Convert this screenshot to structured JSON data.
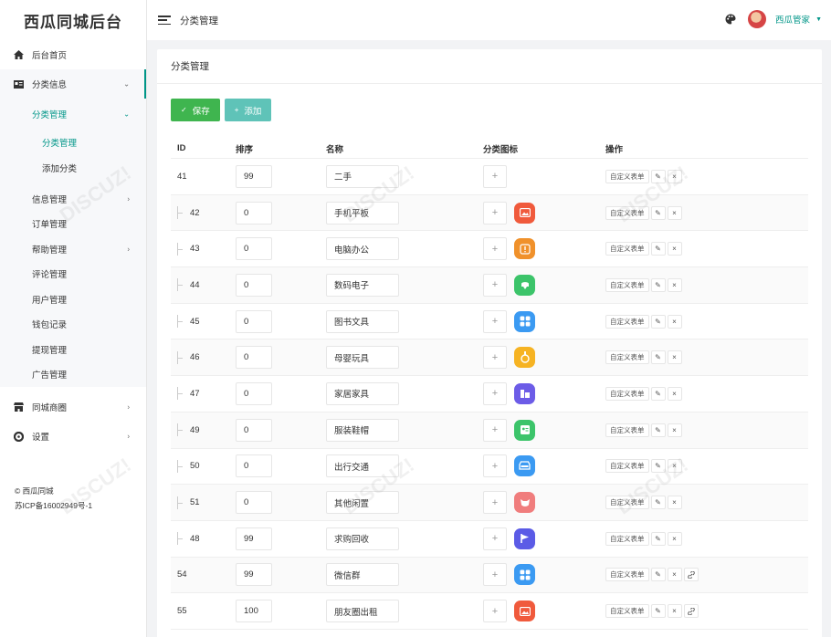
{
  "app": {
    "title": "西瓜同城后台"
  },
  "sidebar": {
    "items": [
      {
        "label": "后台首页",
        "icon": "home-icon"
      },
      {
        "label": "分类信息",
        "icon": "card-icon"
      }
    ],
    "category_sub": {
      "label": "分类管理",
      "children": [
        {
          "label": "分类管理"
        },
        {
          "label": "添加分类"
        }
      ]
    },
    "info_items": [
      {
        "label": "信息管理",
        "has_arrow": true
      },
      {
        "label": "订单管理",
        "has_arrow": false
      },
      {
        "label": "帮助管理",
        "has_arrow": true
      },
      {
        "label": "评论管理",
        "has_arrow": false
      },
      {
        "label": "用户管理",
        "has_arrow": false
      },
      {
        "label": "钱包记录",
        "has_arrow": false
      },
      {
        "label": "提现管理",
        "has_arrow": false
      },
      {
        "label": "广告管理",
        "has_arrow": false
      }
    ],
    "bottom_items": [
      {
        "label": "同城商圈",
        "icon": "shop-icon"
      },
      {
        "label": "设置",
        "icon": "gear-icon"
      }
    ],
    "footer": {
      "copyright": "© 西瓜同城",
      "icp": "苏ICP备16002949号-1"
    }
  },
  "header": {
    "title": "分类管理",
    "username": "西瓜管家"
  },
  "card": {
    "title": "分类管理"
  },
  "toolbar": {
    "save_label": "保存",
    "add_label": "添加"
  },
  "table": {
    "columns": [
      "ID",
      "排序",
      "名称",
      "分类图标",
      "操作"
    ],
    "op_label": "自定义表单",
    "rows": [
      {
        "id": "41",
        "sort": "99",
        "name": "二手",
        "child": false,
        "icon": null,
        "link": false
      },
      {
        "id": "42",
        "sort": "0",
        "name": "手机平板",
        "child": true,
        "icon": {
          "name": "image-icon",
          "color": "#f05a3c"
        },
        "link": false
      },
      {
        "id": "43",
        "sort": "0",
        "name": "电脑办公",
        "child": true,
        "icon": {
          "name": "info-icon",
          "color": "#f0912b"
        },
        "link": false
      },
      {
        "id": "44",
        "sort": "0",
        "name": "数码电子",
        "child": true,
        "icon": {
          "name": "robot-icon",
          "color": "#3cc46a"
        },
        "link": false
      },
      {
        "id": "45",
        "sort": "0",
        "name": "图书文具",
        "child": true,
        "icon": {
          "name": "grid-icon",
          "color": "#3b9af2"
        },
        "link": false
      },
      {
        "id": "46",
        "sort": "0",
        "name": "母婴玩具",
        "child": true,
        "icon": {
          "name": "medal-icon",
          "color": "#f6b323"
        },
        "link": false
      },
      {
        "id": "47",
        "sort": "0",
        "name": "家居家具",
        "child": true,
        "icon": {
          "name": "building-icon",
          "color": "#6c5ce7"
        },
        "link": false
      },
      {
        "id": "49",
        "sort": "0",
        "name": "服装鞋帽",
        "child": true,
        "icon": {
          "name": "id-card-icon",
          "color": "#3cc46a"
        },
        "link": false
      },
      {
        "id": "50",
        "sort": "0",
        "name": "出行交通",
        "child": true,
        "icon": {
          "name": "car-icon",
          "color": "#3b9af2"
        },
        "link": false
      },
      {
        "id": "51",
        "sort": "0",
        "name": "其他闲置",
        "child": true,
        "icon": {
          "name": "pig-icon",
          "color": "#f07d7d"
        },
        "link": false
      },
      {
        "id": "48",
        "sort": "99",
        "name": "求购回收",
        "child": true,
        "icon": {
          "name": "flag-icon",
          "color": "#5b5be6"
        },
        "link": false
      },
      {
        "id": "54",
        "sort": "99",
        "name": "微信群",
        "child": false,
        "icon": {
          "name": "grid-icon",
          "color": "#3b9af2"
        },
        "link": true
      },
      {
        "id": "55",
        "sort": "100",
        "name": "朋友圈出租",
        "child": false,
        "icon": {
          "name": "image-icon",
          "color": "#f05a3c"
        },
        "link": true
      }
    ]
  },
  "colors": {
    "accent": "#009688",
    "save": "#3fb54f",
    "add": "#5fc3b8"
  }
}
